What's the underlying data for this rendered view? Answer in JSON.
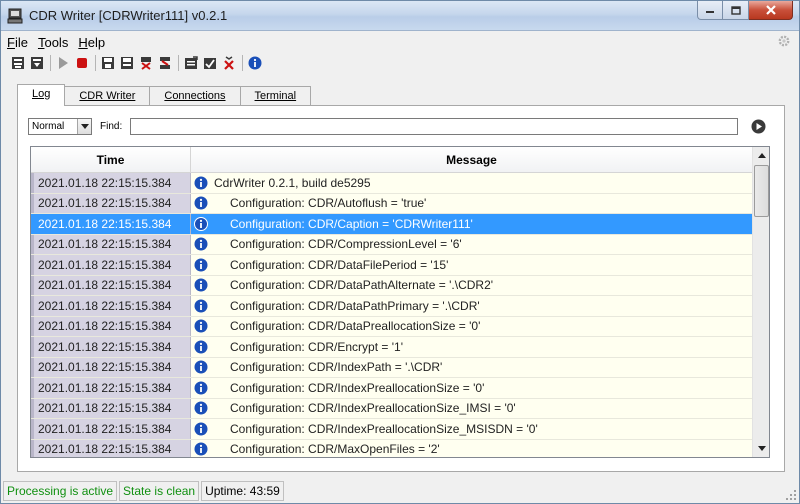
{
  "window": {
    "title": "CDR Writer [CDRWriter111] v0.2.1"
  },
  "menu": [
    {
      "label": "File",
      "key": "F",
      "rest": "ile"
    },
    {
      "label": "Tools",
      "key": "T",
      "rest": "ools"
    },
    {
      "label": "Help",
      "key": "H",
      "rest": "elp"
    }
  ],
  "tabs": [
    "Log",
    "CDR Writer",
    "Connections",
    "Terminal"
  ],
  "filter": {
    "level": "Normal",
    "find_label": "Find:",
    "find_value": ""
  },
  "grid": {
    "headers": {
      "time": "Time",
      "message": "Message"
    },
    "rows": [
      {
        "time": "2021.01.18 22:15:15.384",
        "message": "CdrWriter 0.2.1, build de5295",
        "indent": false
      },
      {
        "time": "2021.01.18 22:15:15.384",
        "message": "Configuration: CDR/Autoflush = 'true'",
        "indent": true
      },
      {
        "time": "2021.01.18 22:15:15.384",
        "message": "Configuration: CDR/Caption = 'CDRWriter111'",
        "indent": true
      },
      {
        "time": "2021.01.18 22:15:15.384",
        "message": "Configuration: CDR/CompressionLevel = '6'",
        "indent": true
      },
      {
        "time": "2021.01.18 22:15:15.384",
        "message": "Configuration: CDR/DataFilePeriod = '15'",
        "indent": true
      },
      {
        "time": "2021.01.18 22:15:15.384",
        "message": "Configuration: CDR/DataPathAlternate = '.\\CDR2'",
        "indent": true
      },
      {
        "time": "2021.01.18 22:15:15.384",
        "message": "Configuration: CDR/DataPathPrimary = '.\\CDR'",
        "indent": true
      },
      {
        "time": "2021.01.18 22:15:15.384",
        "message": "Configuration: CDR/DataPreallocationSize = '0'",
        "indent": true
      },
      {
        "time": "2021.01.18 22:15:15.384",
        "message": "Configuration: CDR/Encrypt = '1'",
        "indent": true
      },
      {
        "time": "2021.01.18 22:15:15.384",
        "message": "Configuration: CDR/IndexPath = '.\\CDR'",
        "indent": true
      },
      {
        "time": "2021.01.18 22:15:15.384",
        "message": "Configuration: CDR/IndexPreallocationSize = '0'",
        "indent": true
      },
      {
        "time": "2021.01.18 22:15:15.384",
        "message": "Configuration: CDR/IndexPreallocationSize_IMSI = '0'",
        "indent": true
      },
      {
        "time": "2021.01.18 22:15:15.384",
        "message": "Configuration: CDR/IndexPreallocationSize_MSISDN = '0'",
        "indent": true
      },
      {
        "time": "2021.01.18 22:15:15.384",
        "message": "Configuration: CDR/MaxOpenFiles = '2'",
        "indent": true
      }
    ],
    "selected_index": 2
  },
  "status": {
    "processing": "Processing is active",
    "state": "State is clean",
    "uptime": "Uptime: 43:59"
  },
  "colors": {
    "selection": "#3399ff",
    "info_icon": "#1a4fb8",
    "status_green": "#109010",
    "stop_red": "#cc1111",
    "row_bg": "#fffff0"
  }
}
